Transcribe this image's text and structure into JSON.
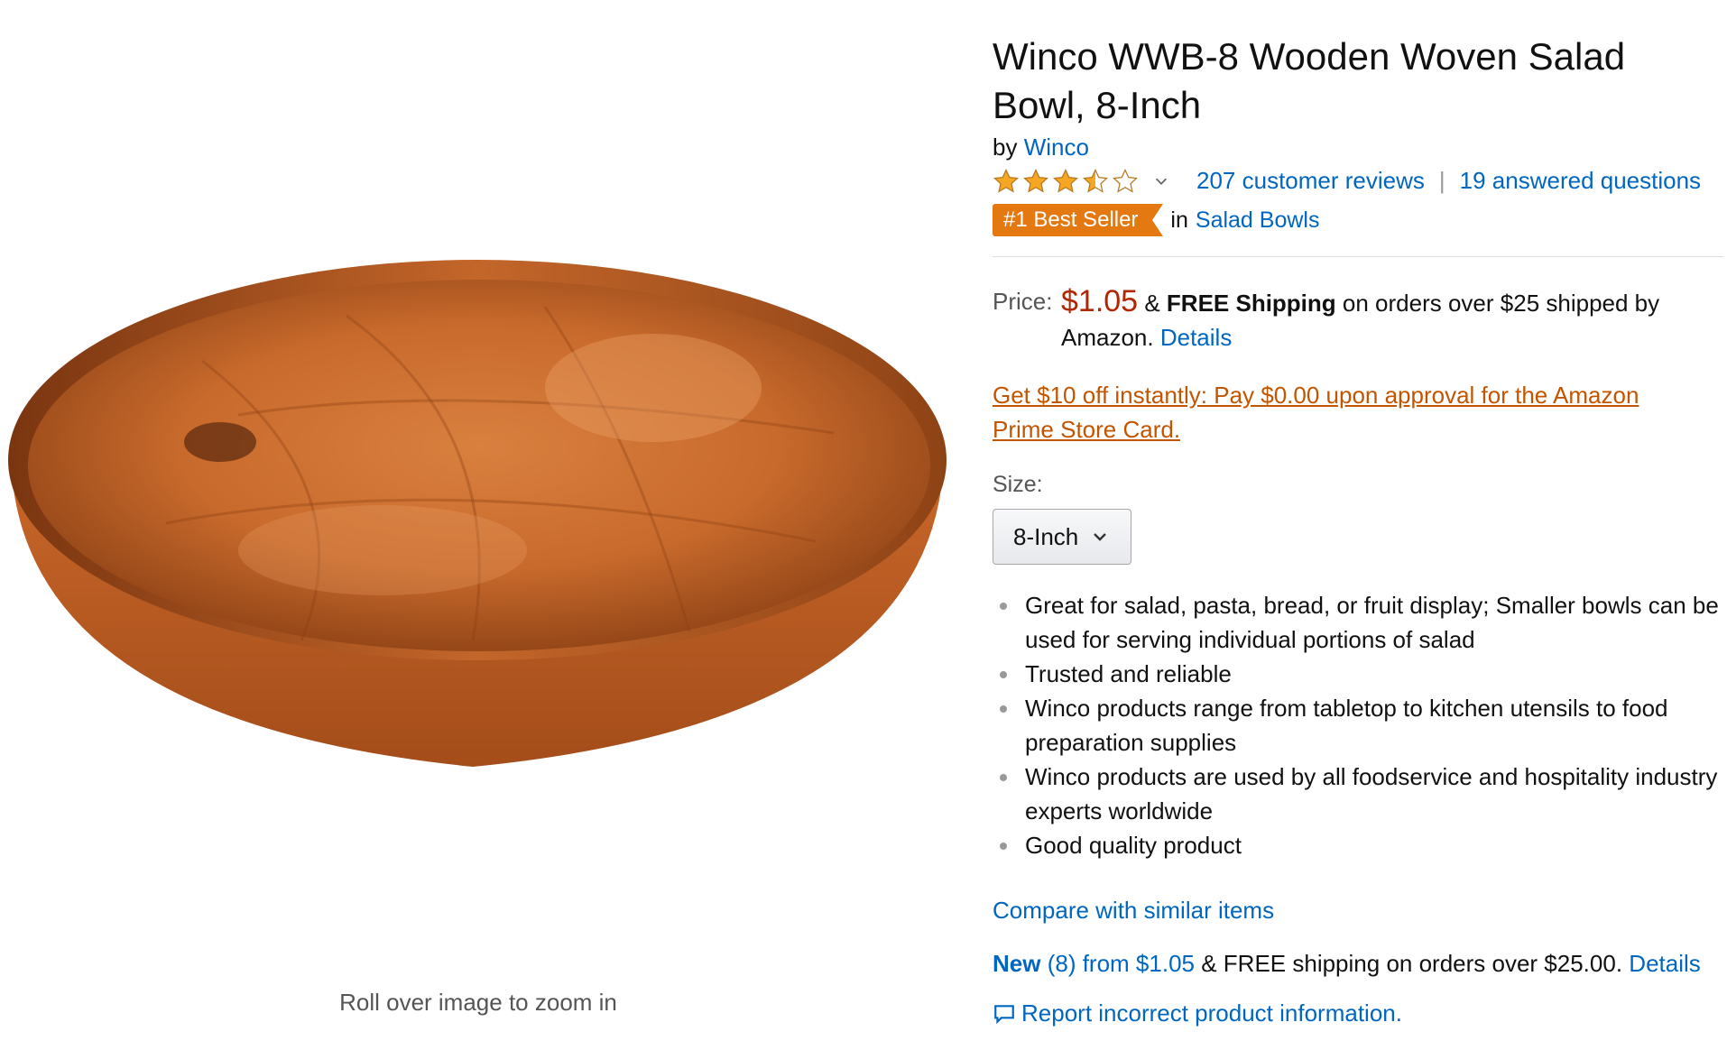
{
  "product": {
    "title": "Winco WWB-8 Wooden Woven Salad Bowl, 8-Inch",
    "by_prefix": "by",
    "brand": "Winco",
    "rating": 3.5,
    "rating_max": 5,
    "reviews_link": "207 customer reviews",
    "rating_separator": "|",
    "questions_link": "19 answered questions",
    "bestseller_badge": "#1 Best Seller",
    "bestseller_in": "in",
    "bestseller_category": "Salad Bowls"
  },
  "price": {
    "label": "Price:",
    "amount": "$1.05",
    "amp": "&",
    "free_shipping": "FREE Shipping",
    "shipping_text": "on orders over $25 shipped by Amazon.",
    "details_link": "Details"
  },
  "promo": {
    "text": "Get $10 off instantly: Pay $0.00 upon approval for the Amazon Prime Store Card."
  },
  "size": {
    "label": "Size:",
    "selected": "8-Inch"
  },
  "bullets": [
    "Great for salad, pasta, bread, or fruit display; Smaller bowls can be used for serving individual portions of salad",
    "Trusted and reliable",
    "Winco products range from tabletop to kitchen utensils to food preparation supplies",
    "Winco products are used by all foodservice and hospitality industry experts worldwide",
    "Good quality product"
  ],
  "compare_link": "Compare with similar items",
  "offers": {
    "new_label": "New",
    "new_count": "(8) from $1.05",
    "shipping_text": "& FREE shipping on orders over $25.00.",
    "details_link": "Details"
  },
  "report_link": "Report incorrect product information.",
  "image": {
    "zoom_hint": "Roll over image to zoom in"
  },
  "colors": {
    "link": "#0066c0",
    "price": "#b12704",
    "promo": "#c45500",
    "badge": "#e47911",
    "star": "#f5a623"
  }
}
